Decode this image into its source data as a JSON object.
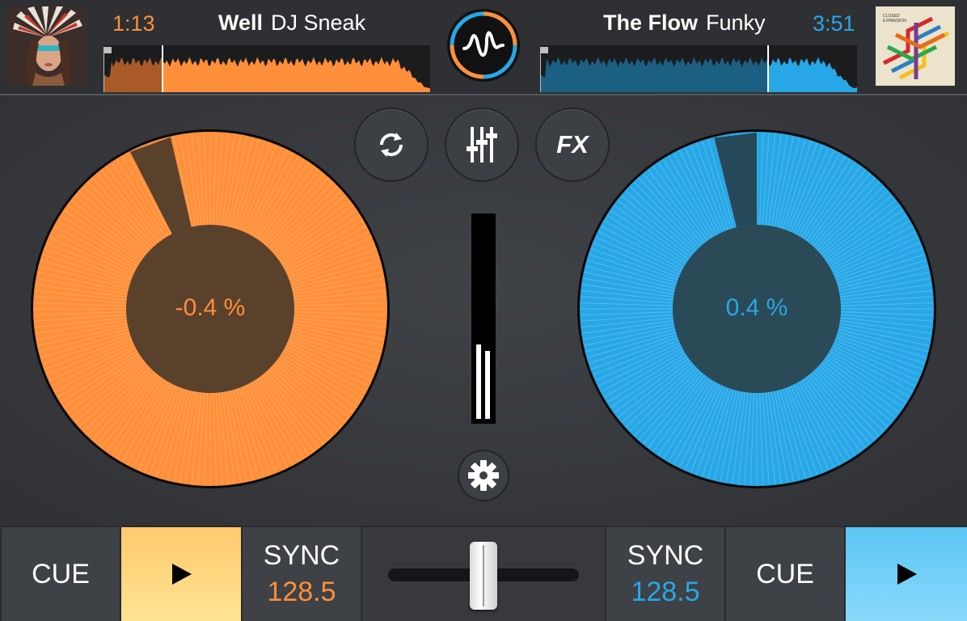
{
  "deck_left": {
    "time": "1:13",
    "title": "Well",
    "artist": "DJ Sneak",
    "pitch": "-0.4 %",
    "cue_label": "CUE",
    "sync_label": "SYNC",
    "bpm": "128.5",
    "color": "#ff8f3a",
    "play_progress": 0.18
  },
  "deck_right": {
    "time": "3:51",
    "title": "The Flow",
    "artist": "Funky",
    "pitch": "0.4 %",
    "cue_label": "CUE",
    "sync_label": "SYNC",
    "bpm": "128.5",
    "color": "#28a7e6",
    "play_progress": 0.72,
    "cover_text": "CLOSED EXPANSION"
  },
  "center": {
    "loop_icon": "loop-icon",
    "mixer_icon": "mixer-sliders-icon",
    "fx_label": "FX",
    "settings_icon": "gear-icon",
    "vu_levels": [
      0.37,
      0.34
    ]
  },
  "crossfader": {
    "position": 0.5
  },
  "colors": {
    "orange": "#ff8f3a",
    "blue": "#28a7e6",
    "background": "#37393c"
  }
}
